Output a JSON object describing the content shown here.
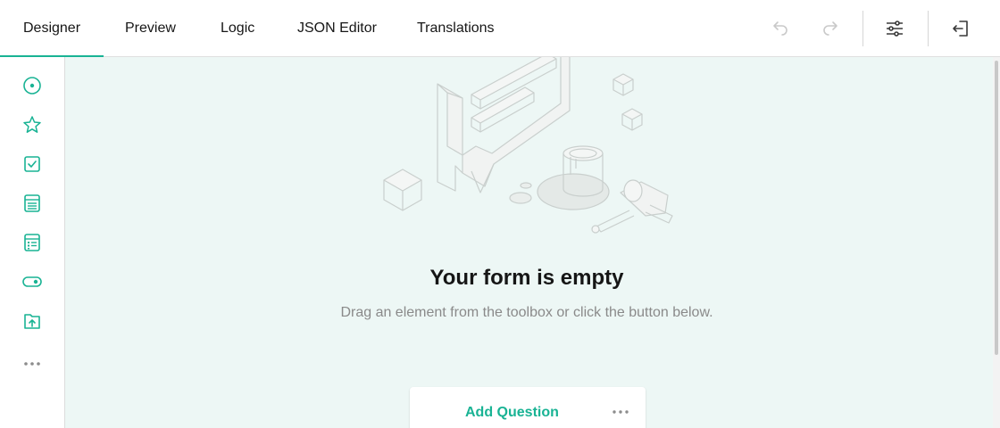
{
  "tabs": [
    {
      "label": "Designer",
      "active": true
    },
    {
      "label": "Preview"
    },
    {
      "label": "Logic"
    },
    {
      "label": "JSON Editor"
    },
    {
      "label": "Translations"
    }
  ],
  "toolbar": {
    "icons": [
      "undo-icon",
      "redo-icon",
      "settings-icon",
      "exit-icon"
    ]
  },
  "toolbox": {
    "items": [
      "radio-icon",
      "rating-star-icon",
      "checkbox-icon",
      "dropdown-icon",
      "matrix-icon",
      "boolean-toggle-icon",
      "file-upload-icon",
      "more-icon"
    ]
  },
  "empty_state": {
    "title": "Your form is empty",
    "subtitle": "Drag an element from the toolbox or click the button below."
  },
  "add_question": {
    "label": "Add Question"
  },
  "colors": {
    "accent": "#19b394",
    "canvas_bg": "#edf7f5"
  }
}
